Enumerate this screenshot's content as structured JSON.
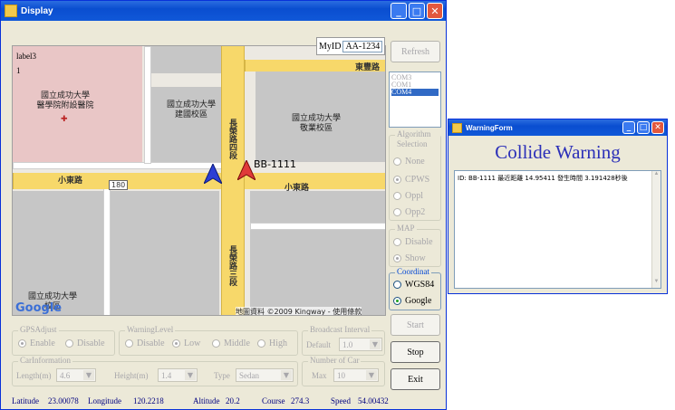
{
  "main": {
    "title": "Display",
    "label3": "label3",
    "label1": "1",
    "myid_label": "MyID",
    "myid_value": "AA-1234",
    "refresh": "Refresh",
    "ports": [
      "COM3",
      "COM1",
      "COM4"
    ],
    "algorithm": {
      "title": "Algorithm Selection",
      "options": [
        "None",
        "CPWS",
        "Oppl",
        "Opp2"
      ],
      "selected": "CPWS"
    },
    "map_group": {
      "title": "MAP",
      "options": [
        "Disable",
        "Show"
      ],
      "selected": "Show"
    },
    "coord": {
      "title": "Coordinat",
      "options": [
        "WGS84",
        "Google"
      ],
      "selected": "Google"
    },
    "start": "Start",
    "stop": "Stop",
    "exit": "Exit",
    "gps": {
      "title": "GPSAdjust",
      "options": [
        "Enable",
        "Disable"
      ],
      "selected": "Enable"
    },
    "warning": {
      "title": "WarningLevel",
      "options": [
        "Disable",
        "Low",
        "Middle",
        "High"
      ],
      "selected": "Low"
    },
    "broadcast": {
      "title": "Broadcast Interval",
      "label": "Default",
      "value": "1.0"
    },
    "car": {
      "title": "CarInformation",
      "length_label": "Length(m)",
      "length": "4.6",
      "height_label": "Height(m)",
      "height": "1.4",
      "type_label": "Type",
      "type": "Sedan"
    },
    "numcar": {
      "title": "Number of Car",
      "label": "Max",
      "value": "10"
    },
    "status": {
      "latitude_label": "Latitude",
      "latitude": "23.00078",
      "longitude_label": "Longitude",
      "longitude": "120.2218",
      "altitude_label": "Altitude",
      "altitude": "20.2",
      "course_label": "Course",
      "course": "274.3",
      "speed_label": "Speed",
      "speed": "54.00432"
    },
    "map": {
      "road_top": "東豐路",
      "road_left": "小東路",
      "road_right": "小東路",
      "road_vert": "長榮路四段",
      "road_vert2": "長榮路三段",
      "num_180": "180",
      "place1": "國立成功大學\n醫學院附設醫院",
      "place2": "國立成功大學\n建國校區",
      "place3": "國立成功大學\n敬業校區",
      "place4": "國立成功大學\n校區",
      "marker_label": "BB-1111",
      "copyright": "地圖資料 ©2009 Kingway - 使用條款",
      "google": "Google"
    }
  },
  "warn": {
    "title": "WarningForm",
    "heading": "Collide Warning",
    "message": "ID: BB-1111   最近距離 14.95411   發生時間 3.191428秒後"
  }
}
